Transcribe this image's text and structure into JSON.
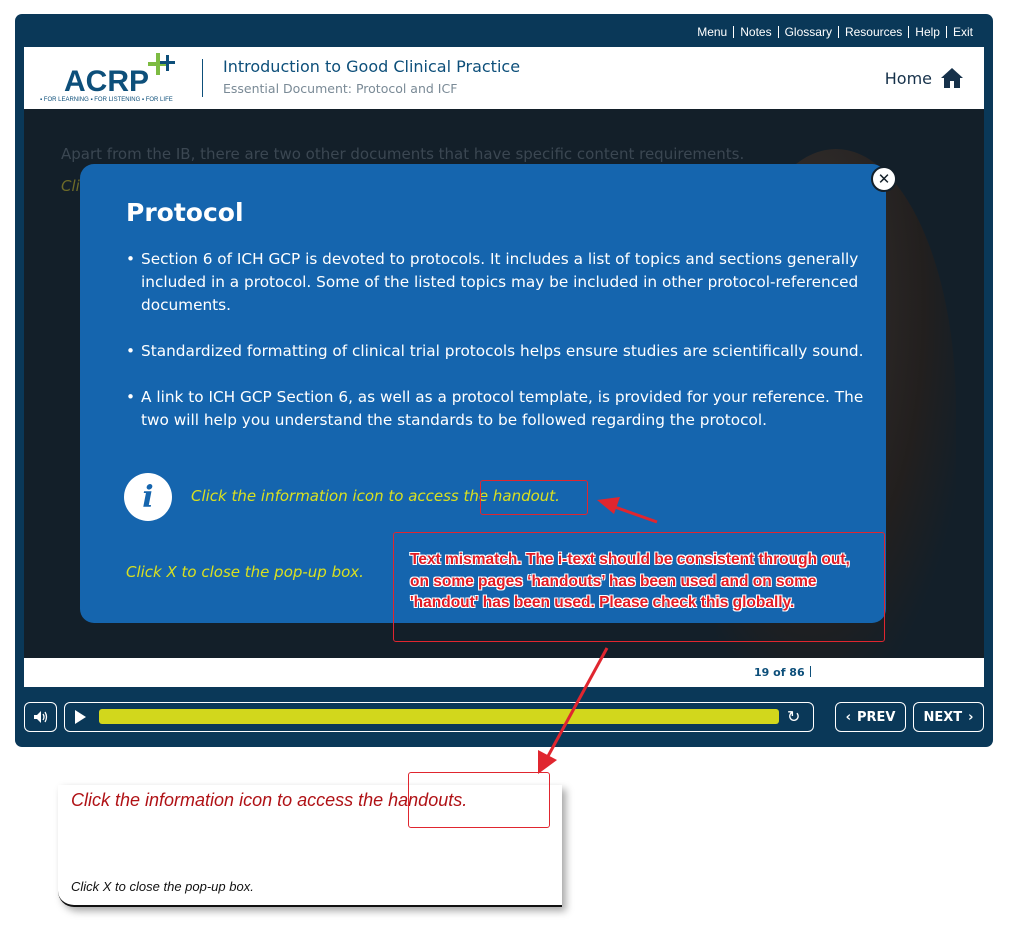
{
  "topnav": {
    "menu": "Menu",
    "notes": "Notes",
    "glossary": "Glossary",
    "resources": "Resources",
    "help": "Help",
    "exit": "Exit"
  },
  "header": {
    "logo_text": "ACRP",
    "logo_tagline": "▪ FOR LEARNING ▪ FOR LISTENING ▪ FOR LIFE",
    "course_title": "Introduction to Good Clinical Practice",
    "course_subtitle": "Essential Document: Protocol and ICF",
    "home_label": "Home"
  },
  "slide": {
    "background_text": "Apart from the IB, there are two other documents that have specific content requirements.",
    "background_text_2": "Cli",
    "popup": {
      "title": "Protocol",
      "bullets": [
        "Section 6 of ICH GCP is devoted to protocols. It includes a list of topics and sections generally included in a protocol. Some of the listed topics may be included in other protocol-referenced documents.",
        "Standardized formatting of clinical trial protocols helps ensure studies are scientifically sound.",
        "A link to ICH GCP Section 6, as well as a protocol template, is provided for your reference. The two will help you understand the standards to be followed regarding the protocol."
      ],
      "info_icon": "i",
      "info_text": "Click the information icon to access the handout.",
      "close_text": "Click X to close the pop-up box.",
      "close_icon": "✕"
    }
  },
  "status": {
    "page_count": "19 of 86"
  },
  "controls": {
    "prev_label": "PREV",
    "next_label": "NEXT",
    "progress_fraction": 1.0,
    "replay_icon": "↻"
  },
  "annotations": {
    "comment_text": "Text mismatch. The i-text should be consistent through out, on some pages ‘handouts’ has been used and on some 'handout' has been used. Please check this globally.",
    "reference_info_text": "Click the information icon to access the handouts.",
    "reference_close_text": "Click X to close the pop-up box."
  },
  "colors": {
    "shell": "#0a3858",
    "popup": "#1565ae",
    "accent_yellow": "#d9e021",
    "annotation_red": "#e0262f"
  }
}
